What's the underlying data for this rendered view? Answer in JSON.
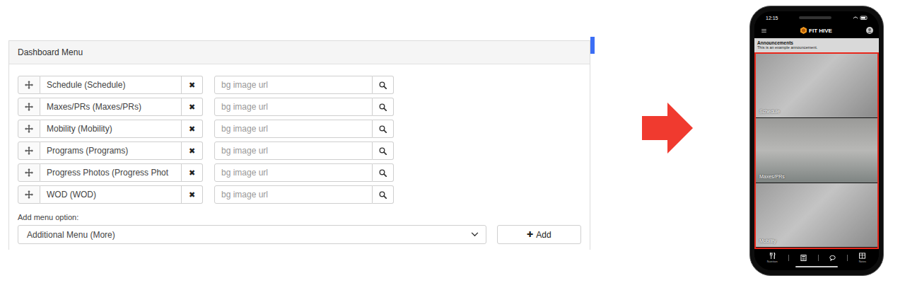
{
  "panel": {
    "title": "Dashboard Menu"
  },
  "menu_items": [
    {
      "label": "Schedule (Schedule)",
      "remove": "✖",
      "bg_placeholder": "bg image url"
    },
    {
      "label": "Maxes/PRs (Maxes/PRs)",
      "remove": "✖",
      "bg_placeholder": "bg image url"
    },
    {
      "label": "Mobility (Mobility)",
      "remove": "✖",
      "bg_placeholder": "bg image url"
    },
    {
      "label": "Programs (Programs)",
      "remove": "✖",
      "bg_placeholder": "bg image url"
    },
    {
      "label": "Progress Photos (Progress Phot",
      "remove": "✖",
      "bg_placeholder": "bg image url"
    },
    {
      "label": "WOD (WOD)",
      "remove": "✖",
      "bg_placeholder": "bg image url"
    }
  ],
  "add": {
    "label": "Add menu option:",
    "selected": "Additional Menu (More)",
    "button_icon": "✚",
    "button": "Add"
  },
  "phone": {
    "time": "12:15",
    "brand": "FIT HIVE",
    "announcement": {
      "title": "Announcements",
      "text": "This is an example announcement."
    },
    "tiles": [
      {
        "label": "Schedule"
      },
      {
        "label": "Maxes/PRs"
      },
      {
        "label": "Mobility"
      }
    ],
    "tab_bar": [
      {
        "kind": "nutrition",
        "label": "Nutrition"
      },
      {
        "kind": "calculator",
        "label": ""
      },
      {
        "kind": "chat",
        "label": ""
      },
      {
        "kind": "notes",
        "label": "Notes"
      }
    ]
  }
}
